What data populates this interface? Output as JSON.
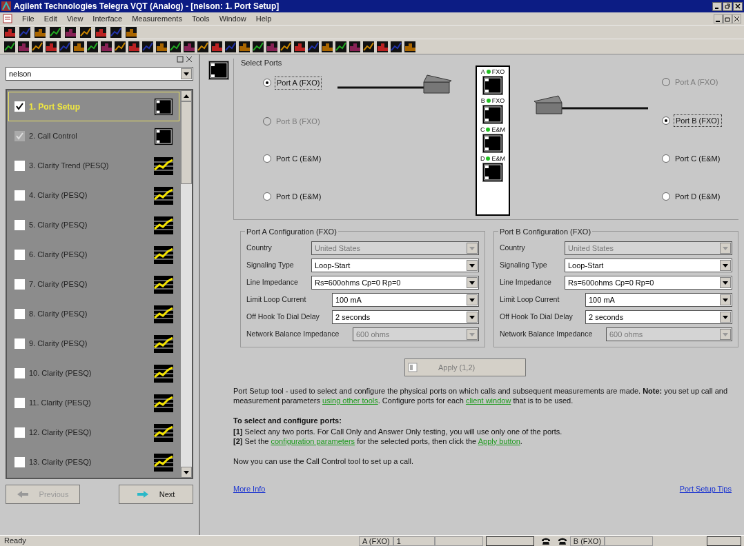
{
  "window": {
    "title": "Agilent Technologies Telegra VQT (Analog) - [nelson: 1. Port Setup]"
  },
  "menu": [
    "File",
    "Edit",
    "View",
    "Interface",
    "Measurements",
    "Tools",
    "Window",
    "Help"
  ],
  "left_panel": {
    "combo": "nelson",
    "items": [
      {
        "label": "1. Port Setup",
        "checked": true,
        "disabled": false,
        "selected": true,
        "kind": "port"
      },
      {
        "label": "2. Call Control",
        "checked": true,
        "disabled": true,
        "selected": false,
        "kind": "port"
      },
      {
        "label": "3. Clarity Trend (PESQ)",
        "checked": false,
        "disabled": false,
        "selected": false,
        "kind": "chart"
      },
      {
        "label": "4. Clarity (PESQ)",
        "checked": false,
        "disabled": false,
        "selected": false,
        "kind": "chart"
      },
      {
        "label": "5. Clarity (PESQ)",
        "checked": false,
        "disabled": false,
        "selected": false,
        "kind": "chart"
      },
      {
        "label": "6. Clarity (PESQ)",
        "checked": false,
        "disabled": false,
        "selected": false,
        "kind": "chart"
      },
      {
        "label": "7. Clarity (PESQ)",
        "checked": false,
        "disabled": false,
        "selected": false,
        "kind": "chart"
      },
      {
        "label": "8. Clarity (PESQ)",
        "checked": false,
        "disabled": false,
        "selected": false,
        "kind": "chart"
      },
      {
        "label": "9. Clarity (PESQ)",
        "checked": false,
        "disabled": false,
        "selected": false,
        "kind": "chart"
      },
      {
        "label": "10. Clarity (PESQ)",
        "checked": false,
        "disabled": false,
        "selected": false,
        "kind": "chart"
      },
      {
        "label": "11. Clarity (PESQ)",
        "checked": false,
        "disabled": false,
        "selected": false,
        "kind": "chart"
      },
      {
        "label": "12. Clarity (PESQ)",
        "checked": false,
        "disabled": false,
        "selected": false,
        "kind": "chart"
      },
      {
        "label": "13. Clarity (PESQ)",
        "checked": false,
        "disabled": false,
        "selected": false,
        "kind": "chart"
      }
    ],
    "buttons": [
      {
        "label": "Previous",
        "disabled": true,
        "kind": "back"
      },
      {
        "label": "Next",
        "disabled": false,
        "kind": "forward"
      }
    ]
  },
  "select_ports": {
    "title": "Select Ports",
    "left": [
      {
        "label": "Port A (FXO)",
        "selected": true,
        "disabled": false
      },
      {
        "label": "Port B (FXO)",
        "selected": false,
        "disabled": true
      },
      {
        "label": "Port C (E&M)",
        "selected": false,
        "disabled": false
      },
      {
        "label": "Port D (E&M)",
        "selected": false,
        "disabled": false
      }
    ],
    "right": [
      {
        "label": "Port A (FXO)",
        "selected": false,
        "disabled": true
      },
      {
        "label": "Port B (FXO)",
        "selected": true,
        "disabled": false
      },
      {
        "label": "Port C (E&M)",
        "selected": false,
        "disabled": false
      },
      {
        "label": "Port D (E&M)",
        "selected": false,
        "disabled": false
      }
    ],
    "device": [
      {
        "letter": "A",
        "type": "FXO"
      },
      {
        "letter": "B",
        "type": "FXO"
      },
      {
        "letter": "C",
        "type": "E&M"
      },
      {
        "letter": "D",
        "type": "E&M"
      }
    ]
  },
  "configs": [
    {
      "title": "Port A Configuration (FXO)",
      "rows": [
        {
          "label": "Country",
          "value": "United States",
          "disabled": true
        },
        {
          "label": "Signaling Type",
          "value": "Loop-Start",
          "disabled": false
        },
        {
          "label": "Line Impedance",
          "value": "Rs=600ohms Cp=0 Rp=0",
          "disabled": false
        },
        {
          "label": "Limit Loop Current",
          "value": "100 mA",
          "disabled": false
        },
        {
          "label": "Off Hook To Dial Delay",
          "value": "2 seconds",
          "disabled": false
        },
        {
          "label": "Network Balance Impedance",
          "value": "600 ohms",
          "disabled": true
        }
      ]
    },
    {
      "title": "Port B Configuration (FXO)",
      "rows": [
        {
          "label": "Country",
          "value": "United States",
          "disabled": true
        },
        {
          "label": "Signaling Type",
          "value": "Loop-Start",
          "disabled": false
        },
        {
          "label": "Line Impedance",
          "value": "Rs=600ohms Cp=0 Rp=0",
          "disabled": false
        },
        {
          "label": "Limit Loop Current",
          "value": "100 mA",
          "disabled": false
        },
        {
          "label": "Off Hook To Dial Delay",
          "value": "2 seconds",
          "disabled": false
        },
        {
          "label": "Network Balance Impedance",
          "value": "600 ohms",
          "disabled": true
        }
      ]
    }
  ],
  "apply_button": {
    "label": "Apply (1,2)",
    "disabled": true
  },
  "help": {
    "description": [
      {
        "kind": "text",
        "text": "Port Setup tool - used to select and configure the physical ports on which calls and subsequent measurements are made. "
      },
      {
        "kind": "bold",
        "text": "Note:"
      },
      {
        "kind": "text",
        "text": " you set up call and measurement parameters "
      },
      {
        "kind": "link",
        "text": "using other tools"
      },
      {
        "kind": "text",
        "text": ". Configure ports for each "
      },
      {
        "kind": "link",
        "text": "client window"
      },
      {
        "kind": "text",
        "text": " that is to be used."
      }
    ],
    "heading": "To select and configure ports:",
    "steps": [
      [
        {
          "kind": "bold",
          "text": "[1]"
        },
        {
          "kind": "text",
          "text": " Select any two ports. For Call Only and Answer Only testing, you will use only one of the ports."
        }
      ],
      [
        {
          "kind": "bold",
          "text": "[2]"
        },
        {
          "kind": "text",
          "text": " Set the "
        },
        {
          "kind": "link",
          "text": "configuration parameters"
        },
        {
          "kind": "text",
          "text": " for the selected ports, then click the "
        },
        {
          "kind": "link",
          "text": "Apply button"
        },
        {
          "kind": "text",
          "text": "."
        }
      ]
    ],
    "closing": "Now you can use the Call Control tool to set up a call.",
    "links": [
      "More Info",
      "Port Setup Tips"
    ]
  },
  "status_bar": {
    "message": "Ready",
    "port_a": "A (FXO)",
    "port_a_count": "1",
    "port_b": "B (FXO)"
  }
}
